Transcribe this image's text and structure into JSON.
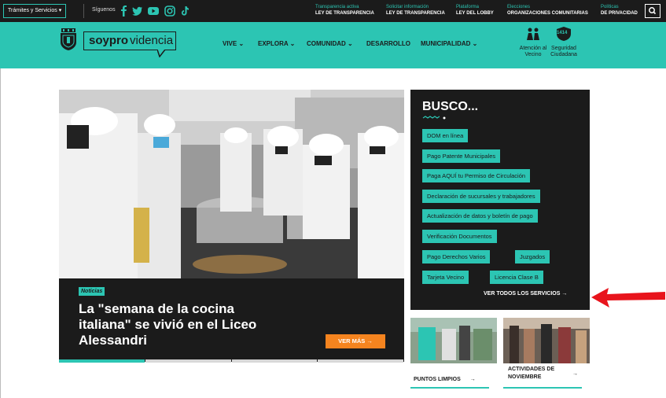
{
  "topbar": {
    "tramites_label": "Trámites y Servicios",
    "siguenos_label": "Síguenos",
    "links": [
      {
        "small": "Transparencia activa",
        "big": "LEY DE TRANSPARENCIA"
      },
      {
        "small": "Solicitar información",
        "big": "LEY DE TRANSPARENCIA"
      },
      {
        "small": "Plataforma",
        "big": "LEY DEL LOBBY"
      },
      {
        "small": "Elecciones",
        "big": "ORGANIZACIONES COMUNITARIAS"
      },
      {
        "small": "Políticas",
        "big": "DE PRIVACIDAD"
      }
    ],
    "social_icons": [
      "facebook-icon",
      "twitter-icon",
      "youtube-icon",
      "instagram-icon",
      "tiktok-icon"
    ]
  },
  "header": {
    "logo_bold": "soypro",
    "logo_light": "videncia",
    "nav": [
      "VIVE",
      "EXPLORA",
      "COMUNIDAD",
      "DESARROLLO",
      "MUNICIPALIDAD"
    ],
    "atencion_label": "Atención al Vecino",
    "seguridad_label": "Seguridad Ciudadana",
    "seguridad_number": "1414"
  },
  "hero": {
    "badge": "Noticias",
    "title": "La \"semana de la cocina italiana\" se vivió en el Liceo Alessandri",
    "cta": "VER MÁS →"
  },
  "busco": {
    "title": "BUSCO...",
    "services": [
      "DOM en línea",
      "Pago Patente Municipales",
      "Paga AQUÍ tu Permiso de Circulación",
      "Declaración de sucursales y trabajadores",
      "Actualización de datos y boletín de pago",
      "Verificación Documentos",
      "Pago Derechos Varios",
      "Juzgados",
      "Tarjeta Vecino",
      "Licencia Clase B"
    ],
    "ver_todos": "VER TODOS LOS SERVICIOS →"
  },
  "cards": [
    {
      "label": "PUNTOS LIMPIOS",
      "arrow": "→"
    },
    {
      "label": "ACTIVIDADES DE NOVIEMBRE",
      "arrow": "→"
    }
  ],
  "colors": {
    "accent": "#2cc5b3",
    "dark": "#1b1b1b",
    "orange": "#f5841f",
    "arrow": "#e8141c"
  }
}
